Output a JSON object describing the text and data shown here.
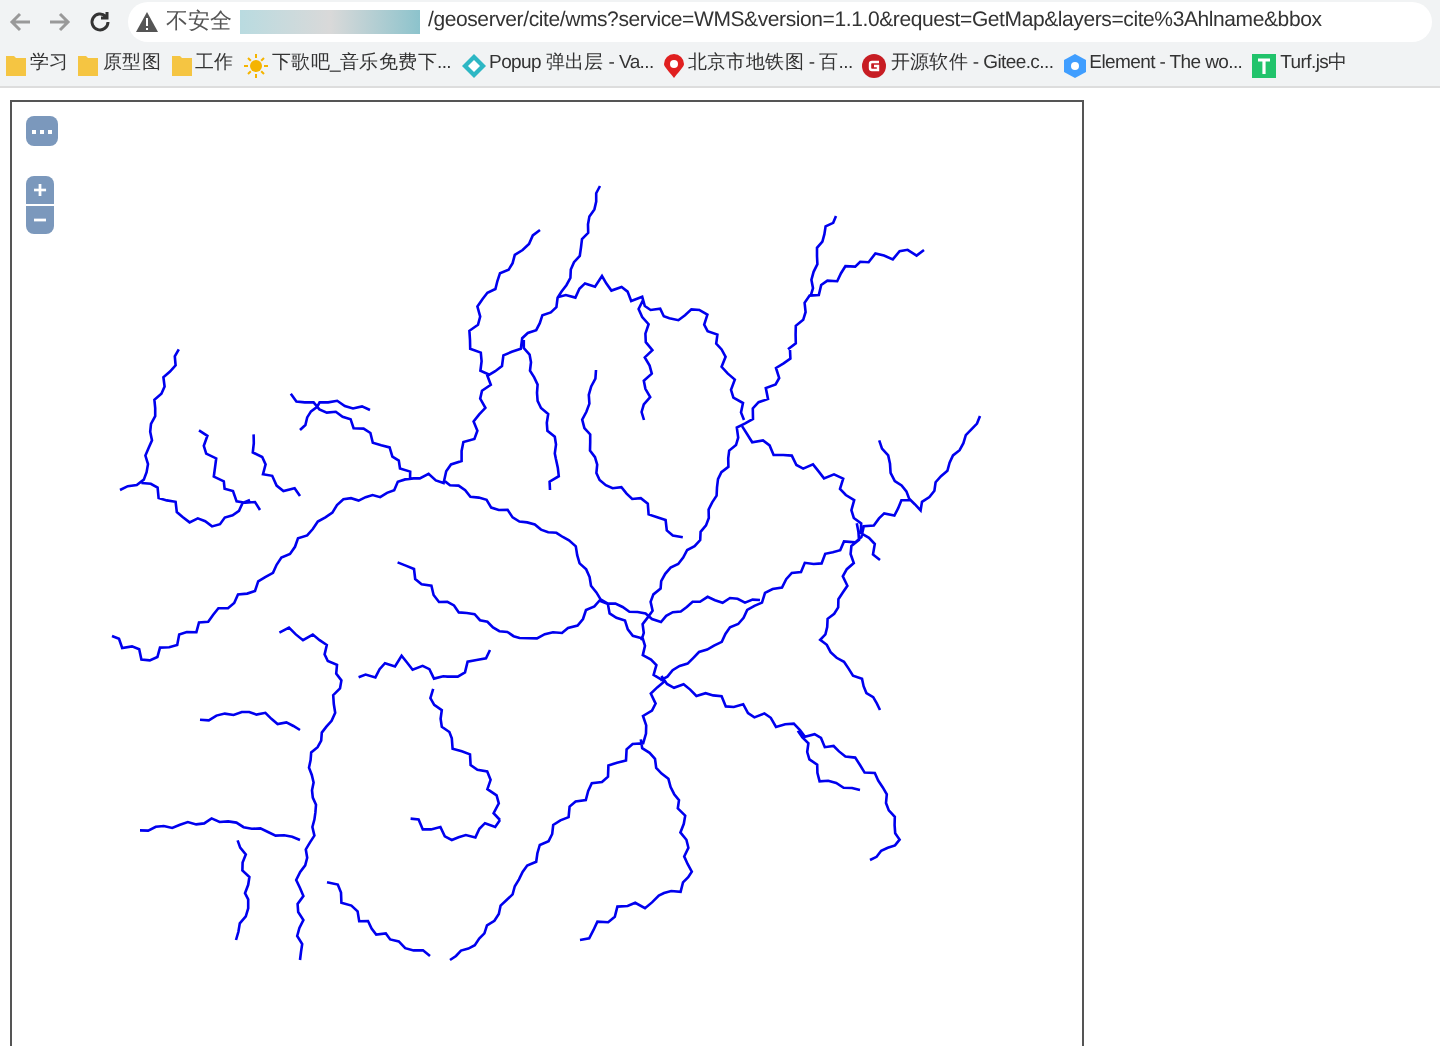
{
  "toolbar": {
    "security_label": "不安全",
    "url": "/geoserver/cite/wms?service=WMS&version=1.1.0&request=GetMap&layers=cite%3Ahlname&bbox"
  },
  "bookmarks": [
    {
      "kind": "folder",
      "label": "学习"
    },
    {
      "kind": "folder",
      "label": "原型图"
    },
    {
      "kind": "folder",
      "label": "工作"
    },
    {
      "kind": "sun",
      "label": "下歌吧_音乐免费下..."
    },
    {
      "kind": "popup",
      "label": "Popup 弹出层 - Va..."
    },
    {
      "kind": "pin",
      "label": "北京市地铁图 - 百..."
    },
    {
      "kind": "gitee",
      "label": "开源软件 - Gitee.c..."
    },
    {
      "kind": "element",
      "label": "Element - The wo..."
    },
    {
      "kind": "turf",
      "label": "Turf.js中"
    }
  ],
  "map": {
    "zoom_in": "+",
    "zoom_out": "−"
  }
}
